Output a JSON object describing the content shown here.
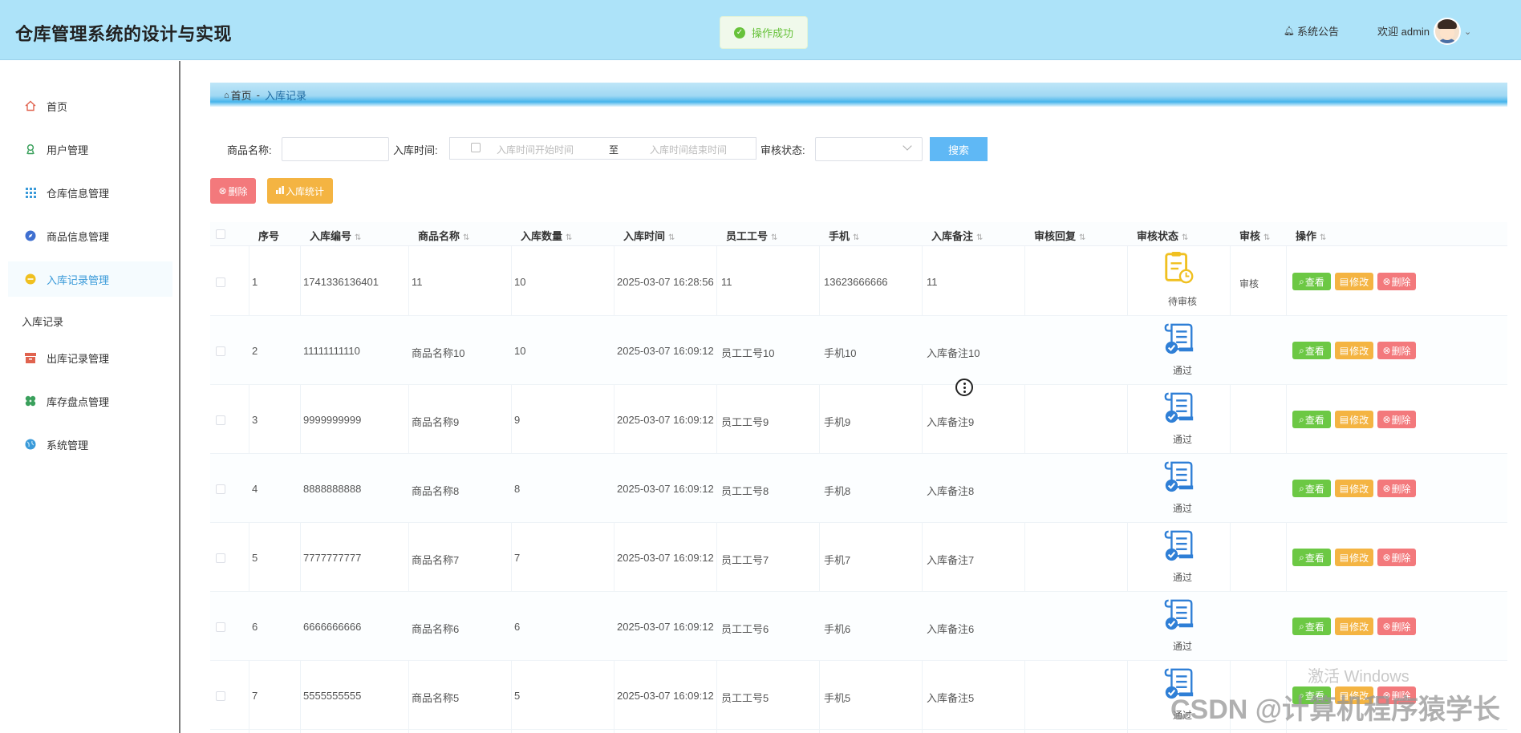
{
  "app": {
    "title": "仓库管理系统的设计与实现"
  },
  "toast": {
    "text": "操作成功"
  },
  "header": {
    "notice_label": "系统公告",
    "welcome_label": "欢迎 admin"
  },
  "sidebar": {
    "items": [
      {
        "label": "首页",
        "icon": "home-icon",
        "color": "#e0634f"
      },
      {
        "label": "用户管理",
        "icon": "user-icon",
        "color": "#3aa05c"
      },
      {
        "label": "仓库信息管理",
        "icon": "grid-icon",
        "color": "#3a9ad9"
      },
      {
        "label": "商品信息管理",
        "icon": "compass-icon",
        "color": "#3f6fd0"
      },
      {
        "label": "入库记录管理",
        "icon": "circle-icon",
        "color": "#f0c020"
      },
      {
        "label": "出库记录管理",
        "icon": "archive-icon",
        "color": "#e0634f"
      },
      {
        "label": "库存盘点管理",
        "icon": "clover-icon",
        "color": "#3aa05c"
      },
      {
        "label": "系统管理",
        "icon": "globe-icon",
        "color": "#3a9ad9"
      }
    ],
    "sub_item": "入库记录"
  },
  "breadcrumb": {
    "home": "首页",
    "separator": "-",
    "current": "入库记录"
  },
  "search": {
    "name_label": "商品名称:",
    "name_value": "",
    "time_label": "入库时间:",
    "start_placeholder": "入库时间开始时间",
    "range_separator": "至",
    "end_placeholder": "入库时间结束时间",
    "status_label": "审核状态:",
    "status_value": "",
    "search_button": "搜索"
  },
  "toolbar": {
    "delete_label": "删除",
    "stats_label": "入库统计"
  },
  "table": {
    "columns": [
      "序号",
      "入库编号",
      "商品名称",
      "入库数量",
      "入库时间",
      "员工工号",
      "手机",
      "入库备注",
      "审核回复",
      "审核状态",
      "审核",
      "操作"
    ],
    "rows": [
      {
        "no": "1",
        "code": "1741336136401",
        "name": "11",
        "qty": "10",
        "time": "2025-03-07 16:28:56",
        "emp": "11",
        "phone": "13623666666",
        "remark": "11",
        "reply": "",
        "status": "待审核",
        "status_kind": "pending",
        "audit": "审核"
      },
      {
        "no": "2",
        "code": "11111111110",
        "name": "商品名称10",
        "qty": "10",
        "time": "2025-03-07 16:09:12",
        "emp": "员工工号10",
        "phone": "手机10",
        "remark": "入库备注10",
        "reply": "",
        "status": "通过",
        "status_kind": "passed",
        "audit": ""
      },
      {
        "no": "3",
        "code": "9999999999",
        "name": "商品名称9",
        "qty": "9",
        "time": "2025-03-07 16:09:12",
        "emp": "员工工号9",
        "phone": "手机9",
        "remark": "入库备注9",
        "reply": "",
        "status": "通过",
        "status_kind": "passed",
        "audit": ""
      },
      {
        "no": "4",
        "code": "8888888888",
        "name": "商品名称8",
        "qty": "8",
        "time": "2025-03-07 16:09:12",
        "emp": "员工工号8",
        "phone": "手机8",
        "remark": "入库备注8",
        "reply": "",
        "status": "通过",
        "status_kind": "passed",
        "audit": ""
      },
      {
        "no": "5",
        "code": "7777777777",
        "name": "商品名称7",
        "qty": "7",
        "time": "2025-03-07 16:09:12",
        "emp": "员工工号7",
        "phone": "手机7",
        "remark": "入库备注7",
        "reply": "",
        "status": "通过",
        "status_kind": "passed",
        "audit": ""
      },
      {
        "no": "6",
        "code": "6666666666",
        "name": "商品名称6",
        "qty": "6",
        "time": "2025-03-07 16:09:12",
        "emp": "员工工号6",
        "phone": "手机6",
        "remark": "入库备注6",
        "reply": "",
        "status": "通过",
        "status_kind": "passed",
        "audit": ""
      },
      {
        "no": "7",
        "code": "5555555555",
        "name": "商品名称5",
        "qty": "5",
        "time": "2025-03-07 16:09:12",
        "emp": "员工工号5",
        "phone": "手机5",
        "remark": "入库备注5",
        "reply": "",
        "status": "通过",
        "status_kind": "passed",
        "audit": ""
      }
    ],
    "actions": {
      "view": "查看",
      "edit": "修改",
      "delete": "删除"
    }
  },
  "watermarks": {
    "windows": "激活 Windows",
    "csdn": "CSDN @计算机程序猿学长"
  },
  "colors": {
    "header_bg": "#ade3f9",
    "accent": "#5fb8f5",
    "success": "#67c23a",
    "warning": "#f4b442",
    "danger": "#f3797c",
    "view": "#6cc844"
  }
}
